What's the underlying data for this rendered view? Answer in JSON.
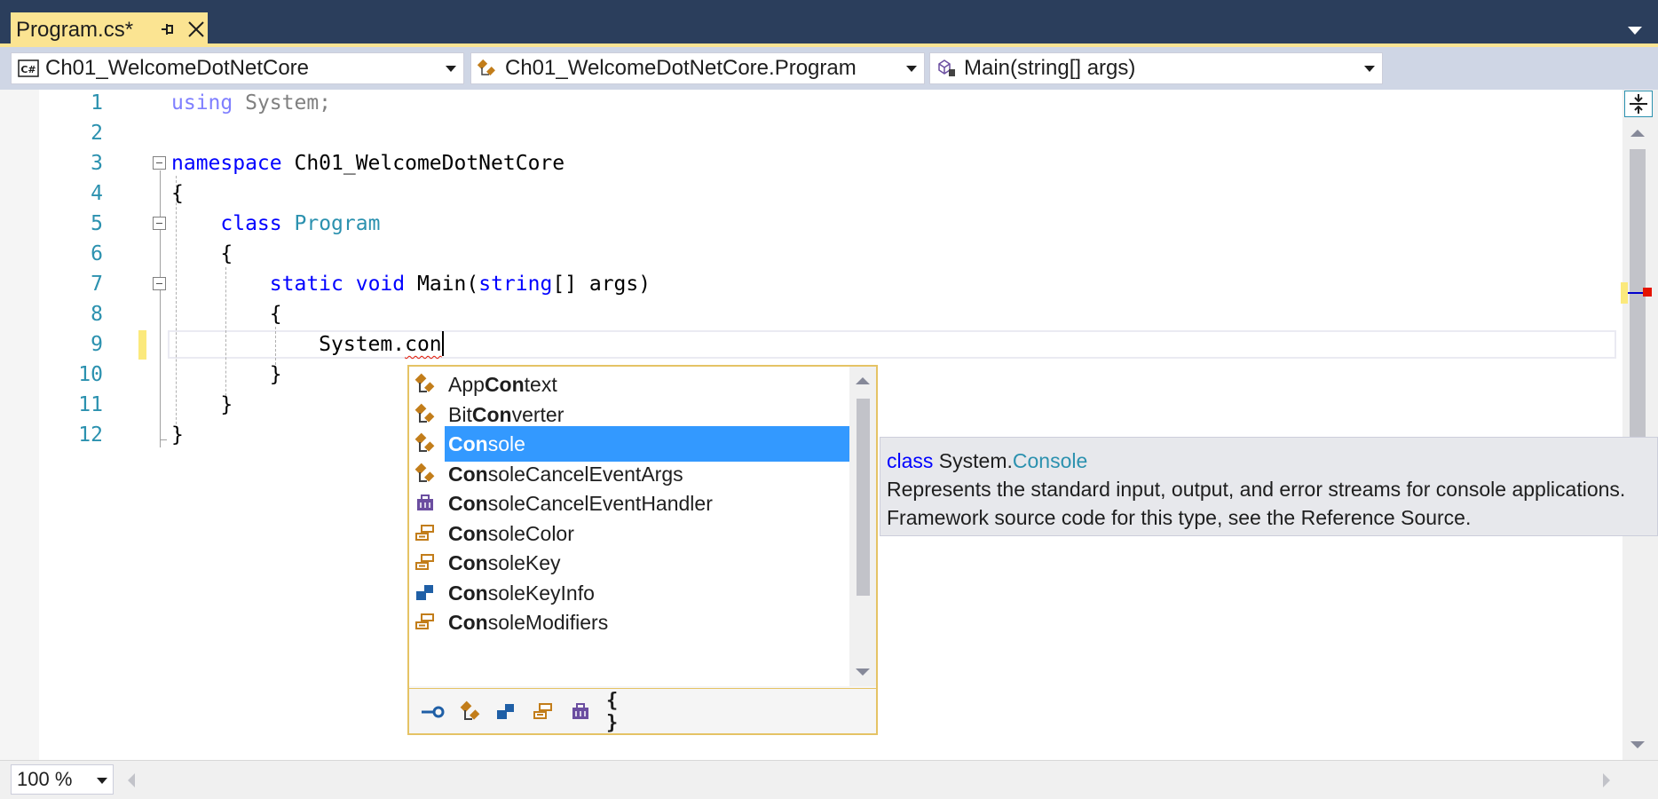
{
  "tab": {
    "title": "Program.cs*",
    "pin_icon": "pin-icon",
    "close_icon": "close-icon"
  },
  "navbar": {
    "project": {
      "label": "Ch01_WelcomeDotNetCore",
      "icon": "csharp-icon"
    },
    "type": {
      "label": "Ch01_WelcomeDotNetCore.Program",
      "icon": "class-icon"
    },
    "member": {
      "label": "Main(string[] args)",
      "icon": "method-icon"
    }
  },
  "editor": {
    "line_numbers": [
      "1",
      "2",
      "3",
      "4",
      "5",
      "6",
      "7",
      "8",
      "9",
      "10",
      "11",
      "12"
    ],
    "lines": [
      [
        {
          "t": "using",
          "c": "kw-dim"
        },
        {
          "t": " System;",
          "c": "txt-dim"
        }
      ],
      [],
      [
        {
          "t": "namespace",
          "c": "kw"
        },
        {
          "t": " Ch01_WelcomeDotNetCore",
          "c": ""
        }
      ],
      [
        {
          "t": "{",
          "c": ""
        }
      ],
      [
        {
          "t": "    ",
          "c": ""
        },
        {
          "t": "class",
          "c": "kw"
        },
        {
          "t": " ",
          "c": ""
        },
        {
          "t": "Program",
          "c": "type"
        }
      ],
      [
        {
          "t": "    {",
          "c": ""
        }
      ],
      [
        {
          "t": "        ",
          "c": ""
        },
        {
          "t": "static",
          "c": "kw"
        },
        {
          "t": " ",
          "c": ""
        },
        {
          "t": "void",
          "c": "kw"
        },
        {
          "t": " Main(",
          "c": ""
        },
        {
          "t": "string",
          "c": "kw"
        },
        {
          "t": "[] args)",
          "c": ""
        }
      ],
      [
        {
          "t": "        {",
          "c": ""
        }
      ],
      [
        {
          "t": "            System.",
          "c": ""
        },
        {
          "t": "con",
          "c": "squiggle"
        }
      ],
      [
        {
          "t": "        }",
          "c": ""
        }
      ],
      [
        {
          "t": "    }",
          "c": ""
        }
      ],
      [
        {
          "t": "}",
          "c": ""
        }
      ]
    ]
  },
  "completion": {
    "items": [
      {
        "pre": "App",
        "bold": "Con",
        "post": "text",
        "icon": "class-icon",
        "selected": false
      },
      {
        "pre": "Bit",
        "bold": "Con",
        "post": "verter",
        "icon": "class-icon",
        "selected": false
      },
      {
        "pre": "",
        "bold": "Con",
        "post": "sole",
        "icon": "class-icon",
        "selected": true
      },
      {
        "pre": "",
        "bold": "Con",
        "post": "soleCancelEventArgs",
        "icon": "class-icon",
        "selected": false
      },
      {
        "pre": "",
        "bold": "Con",
        "post": "soleCancelEventHandler",
        "icon": "delegate-icon",
        "selected": false
      },
      {
        "pre": "",
        "bold": "Con",
        "post": "soleColor",
        "icon": "enum-icon",
        "selected": false
      },
      {
        "pre": "",
        "bold": "Con",
        "post": "soleKey",
        "icon": "enum-icon",
        "selected": false
      },
      {
        "pre": "",
        "bold": "Con",
        "post": "soleKeyInfo",
        "icon": "struct-icon",
        "selected": false
      },
      {
        "pre": "",
        "bold": "Con",
        "post": "soleModifiers",
        "icon": "enum-icon",
        "selected": false
      }
    ],
    "filters": [
      {
        "name": "interface-filter",
        "icon": "interface-icon"
      },
      {
        "name": "class-filter",
        "icon": "class-icon"
      },
      {
        "name": "struct-filter",
        "icon": "struct-icon"
      },
      {
        "name": "enum-filter",
        "icon": "enum-icon"
      },
      {
        "name": "delegate-filter",
        "icon": "delegate-icon"
      },
      {
        "name": "namespace-filter",
        "icon": "namespace-icon",
        "label": "{ }"
      }
    ]
  },
  "quickinfo": {
    "keyword": "class",
    "namespace": " System.",
    "type": "Console",
    "line2": "Represents the standard input, output, and error streams for console applications.",
    "line3": "Framework source code for this type, see the Reference Source."
  },
  "status": {
    "zoom": "100 %"
  },
  "colors": {
    "accent_tab": "#fbe492",
    "tabstrip": "#2b3e5c",
    "selection": "#3399ff",
    "keyword": "#0000ff",
    "type": "#2b91af",
    "line_number": "#2b91af"
  }
}
